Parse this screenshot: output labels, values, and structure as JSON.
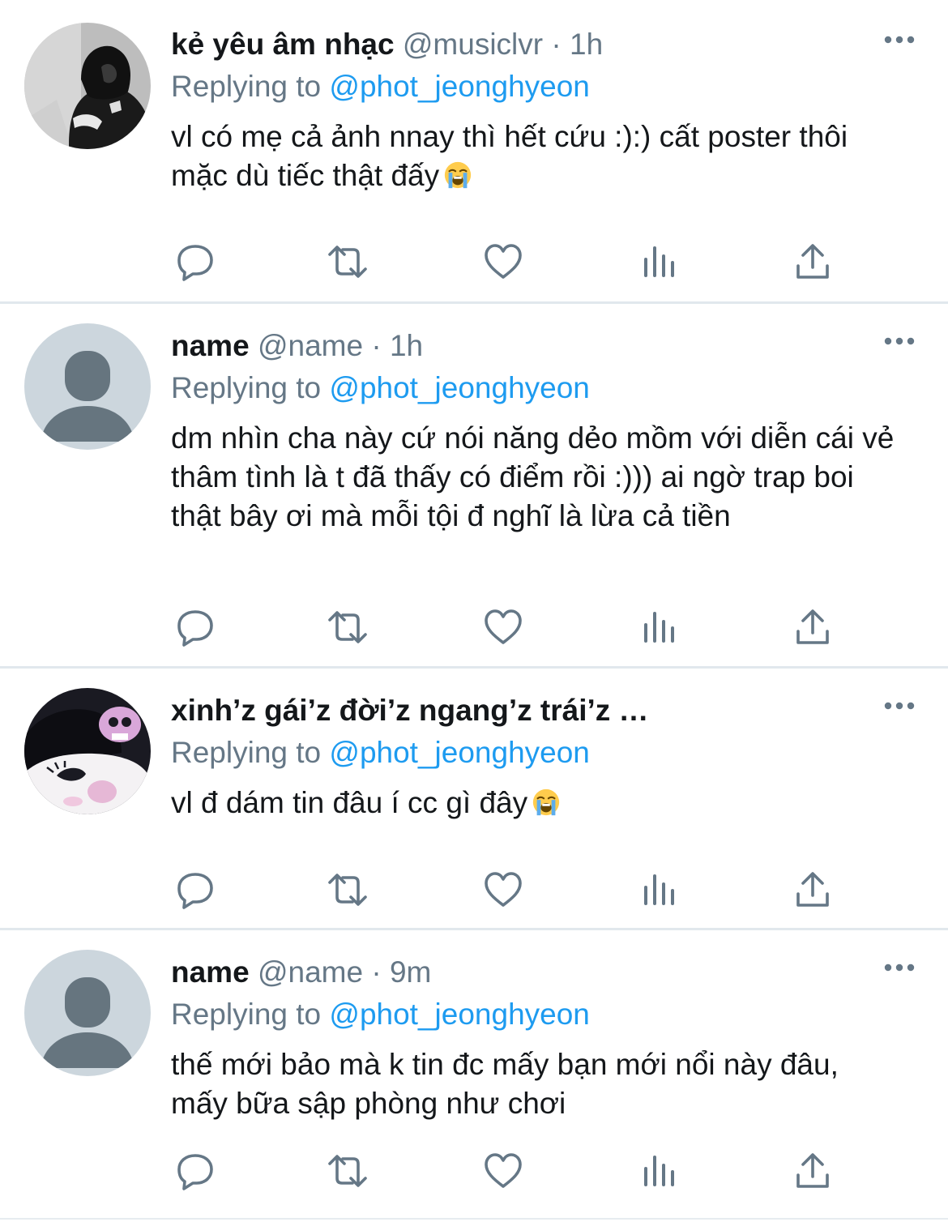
{
  "reply_prefix": "Replying to",
  "colors": {
    "text": "#14171a",
    "secondary": "#657786",
    "link": "#1d9bf0",
    "separator": "#e1e8ed"
  },
  "tweets": [
    {
      "display_name": "kẻ yêu âm nhạc",
      "handle": "@musiclvr",
      "dot": "·",
      "time": "1h",
      "reply_to": "@phot_jeonghyeon",
      "text": "vl có mẹ cả ảnh nnay thì hết cứu :):) cất poster thôi mặc dù tiếc thật đấy",
      "emoji": "loudly-crying-face",
      "avatar": "photo-hooded-person"
    },
    {
      "display_name": "name",
      "handle": "@name",
      "dot": "·",
      "time": "1h",
      "reply_to": "@phot_jeonghyeon",
      "text": "dm nhìn cha này cứ nói năng dẻo mồm với diễn cái vẻ thâm tình là t đã thấy có điểm rồi :))) ai ngờ trap boi thật bây ơi mà mỗi tội đ nghĩ là lừa cả tiền",
      "avatar": "default-avatar"
    },
    {
      "display_name": "xinh’z gái’z đời’z ngang’z trái’z …",
      "handle": "",
      "dot": "",
      "time": "",
      "reply_to": "@phot_jeonghyeon",
      "text": "vl đ dám tin đâu í cc gì đây",
      "emoji": "loudly-crying-face",
      "avatar": "cartoon-kuromi"
    },
    {
      "display_name": "name",
      "handle": "@name",
      "dot": "·",
      "time": "9m",
      "reply_to": "@phot_jeonghyeon",
      "text": "thế mới bảo mà k tin đc mấy bạn mới nổi này đâu, mấy bữa sập phòng như chơi",
      "avatar": "default-avatar"
    }
  ],
  "action_icons": [
    "reply-icon",
    "retweet-icon",
    "like-icon",
    "analytics-icon",
    "share-icon"
  ]
}
